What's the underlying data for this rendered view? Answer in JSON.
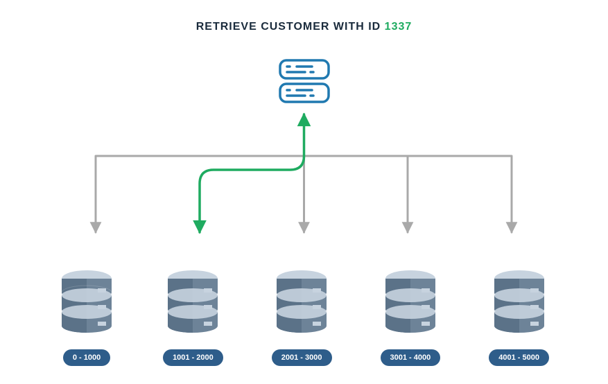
{
  "title": {
    "prefix": "RETRIEVE CUSTOMER WITH ID ",
    "highlighted_id": "1337"
  },
  "colors": {
    "title_text": "#1a2b3c",
    "highlight": "#1fab60",
    "server_stroke": "#2079b0",
    "pill_bg": "#2e5d8a",
    "arrow_gray": "#a9a9a9",
    "arrow_green": "#1fab60",
    "db_top": "#c7d3df",
    "db_body": "#5b7288",
    "db_body_light": "#6d8398"
  },
  "selected_shard_index": 1,
  "shards": [
    {
      "range": "0 - 1000"
    },
    {
      "range": "1001 - 2000"
    },
    {
      "range": "2001 - 3000"
    },
    {
      "range": "3001 - 4000"
    },
    {
      "range": "4001 - 5000"
    }
  ]
}
